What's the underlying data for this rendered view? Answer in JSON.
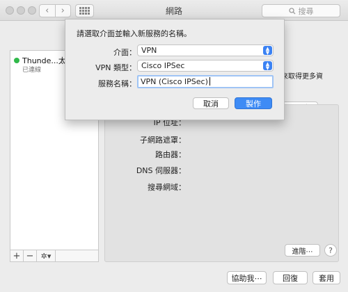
{
  "window": {
    "title": "網路"
  },
  "search": {
    "placeholder": "搜尋"
  },
  "sidebar": {
    "service": {
      "name": "Thunde...太網路",
      "status": "已連線"
    },
    "tools": {
      "add": "+",
      "remove": "−",
      "gear": "✲▾"
    }
  },
  "sheet": {
    "prompt": "請選取介面並輸入新服務的名稱。",
    "interface_label": "介面：",
    "interface_value": "VPN",
    "vpn_type_label": "VPN 類型：",
    "vpn_type_value": "Cisco IPSec",
    "service_name_label": "服務名稱：",
    "service_name_value": "VPN (Cisco IPSec)",
    "cancel": "取消",
    "create": "製作"
  },
  "detail": {
    "hint": "來取得更多資",
    "ip_label": "IP 位址：",
    "subnet_label": "子網路遮罩：",
    "router_label": "路由器：",
    "dns_label": "DNS 伺服器：",
    "search_domain_label": "搜尋網域：",
    "advanced": "進階⋯",
    "help": "?"
  },
  "buttons": {
    "assist": "協助我⋯",
    "revert": "回復",
    "apply": "套用"
  },
  "colors": {
    "accent": "#3e8bf5",
    "connected": "#30b94a"
  }
}
